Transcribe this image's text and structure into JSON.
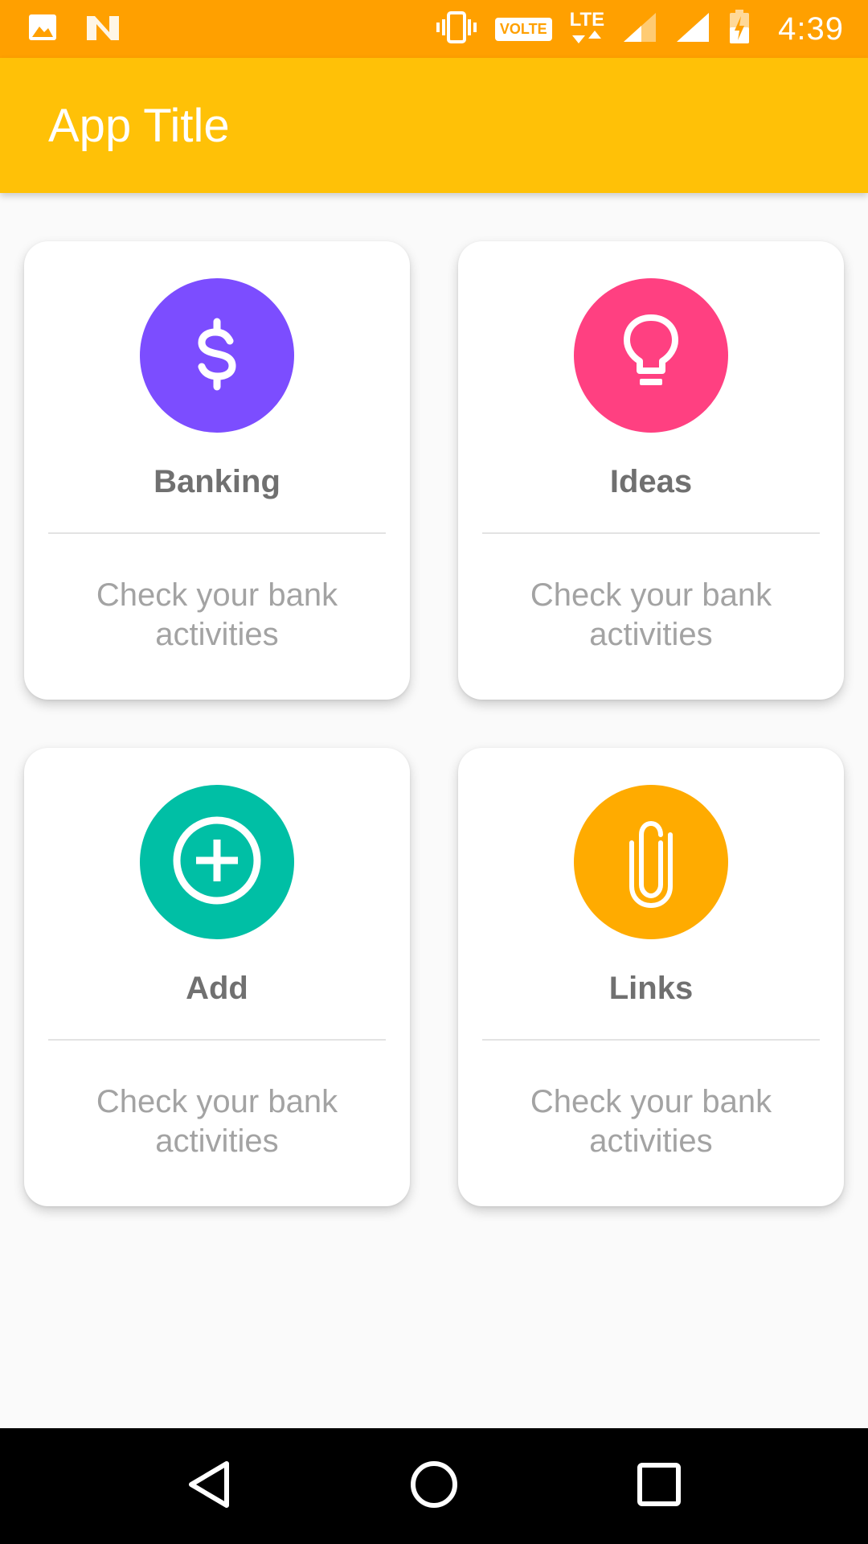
{
  "status_bar": {
    "time": "4:39",
    "volte_label": "VOLTE",
    "lte_label": "LTE",
    "icons": [
      "image-icon",
      "n-notification-icon",
      "vibrate-icon",
      "volte-icon",
      "lte-icon",
      "signal-icon",
      "signal-full-icon",
      "battery-charging-icon"
    ]
  },
  "app_bar": {
    "title": "App Title",
    "color": "#ffc107"
  },
  "cards": [
    {
      "title": "Banking",
      "description": "Check your bank activities",
      "icon": "dollar-icon",
      "color": "#7c4dff"
    },
    {
      "title": "Ideas",
      "description": "Check your bank activities",
      "icon": "lightbulb-icon",
      "color": "#ff4081"
    },
    {
      "title": "Add",
      "description": "Check your bank activities",
      "icon": "add-circle-icon",
      "color": "#00bfa5"
    },
    {
      "title": "Links",
      "description": "Check your bank activities",
      "icon": "paperclip-icon",
      "color": "#ffab00"
    }
  ],
  "nav_bar": {
    "buttons": [
      "back-icon",
      "home-icon",
      "recents-icon"
    ]
  }
}
